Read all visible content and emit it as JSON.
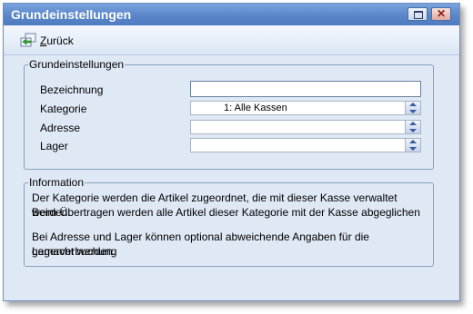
{
  "window": {
    "title": "Grundeinstellungen"
  },
  "toolbar": {
    "back_label": "Zurück",
    "back_icon": "back-arrow-icon"
  },
  "group1": {
    "legend": "Grundeinstellungen",
    "rows": [
      {
        "label": "Bezeichnung",
        "value": "",
        "type": "text"
      },
      {
        "label": "Kategorie",
        "value": "1: Alle Kassen",
        "type": "select"
      },
      {
        "label": "Adresse",
        "value": "",
        "type": "select"
      },
      {
        "label": "Lager",
        "value": "",
        "type": "select"
      }
    ]
  },
  "info": {
    "legend": "Information",
    "line1": "Der Kategorie werden die Artikel zugeordnet, die mit dieser Kasse verwaltet werden.",
    "line2": "Beim Übertragen werden alle Artikel dieser Kategorie mit der Kasse abgeglichen",
    "line3": "Bei Adresse und Lager können optional abweichende Angaben für die Lagerverbuchung",
    "line4": "gemacht werden."
  },
  "colors": {
    "titlebar": "#5a86c9",
    "window_bg": "#dfe8f5",
    "border": "#8aa0c0"
  }
}
